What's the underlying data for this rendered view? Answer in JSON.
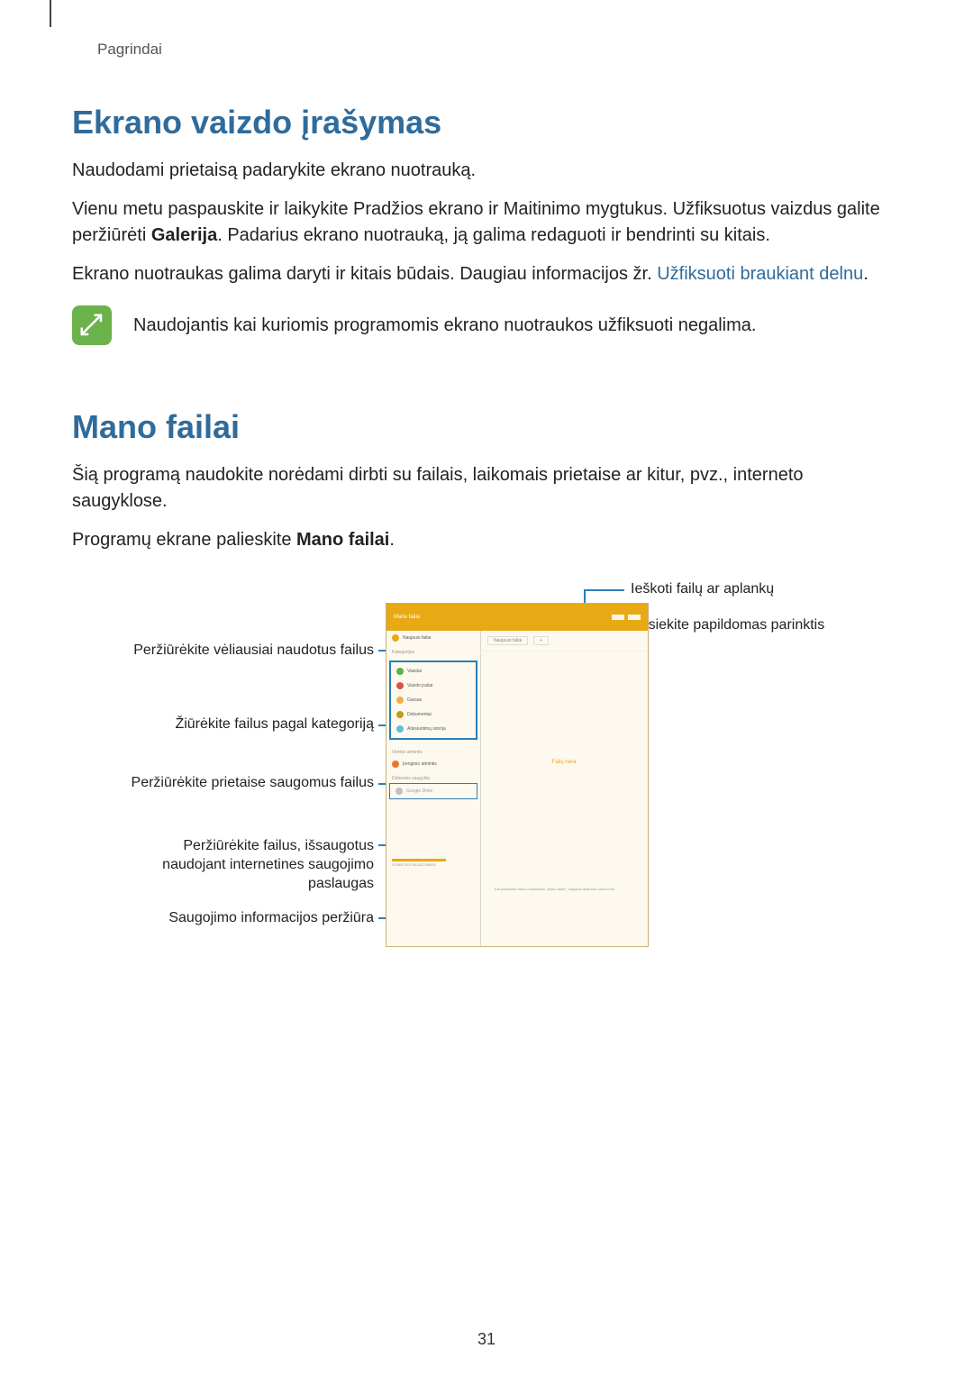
{
  "breadcrumb": "Pagrindai",
  "section1": {
    "title": "Ekrano vaizdo įrašymas",
    "p1": "Naudodami prietaisą padarykite ekrano nuotrauką.",
    "p2a": "Vienu metu paspauskite ir laikykite Pradžios ekrano ir Maitinimo mygtukus. Užfiksuotus vaizdus galite peržiūrėti ",
    "p2bold": "Galerija",
    "p2b": ". Padarius ekrano nuotrauką, ją galima redaguoti ir bendrinti su kitais.",
    "p3a": "Ekrano nuotraukas galima daryti ir kitais būdais. Daugiau informacijos žr. ",
    "p3link": "Užfiksuoti braukiant delnu",
    "p3b": ".",
    "note": "Naudojantis kai kuriomis programomis ekrano nuotraukos užfiksuoti negalima."
  },
  "section2": {
    "title": "Mano failai",
    "p1": "Šią programą naudokite norėdami dirbti su failais, laikomais prietaise ar kitur, pvz., interneto saugyklose.",
    "p2a": "Programų ekrane palieskite ",
    "p2bold": "Mano failai",
    "p2b": "."
  },
  "callouts": {
    "l1": "Peržiūrėkite vėliausiai naudotus failus",
    "l2": "Žiūrėkite failus pagal kategoriją",
    "l3": "Peržiūrėkite prietaise saugomus failus",
    "l4": "Peržiūrėkite failus, išsaugotus naudojant internetines saugojimo paslaugas",
    "l5": "Saugojimo informacijos peržiūra",
    "r1": "Ieškoti failų ar aplankų",
    "r2": "Pasiekite papildomas parinktis"
  },
  "page_number": "31"
}
